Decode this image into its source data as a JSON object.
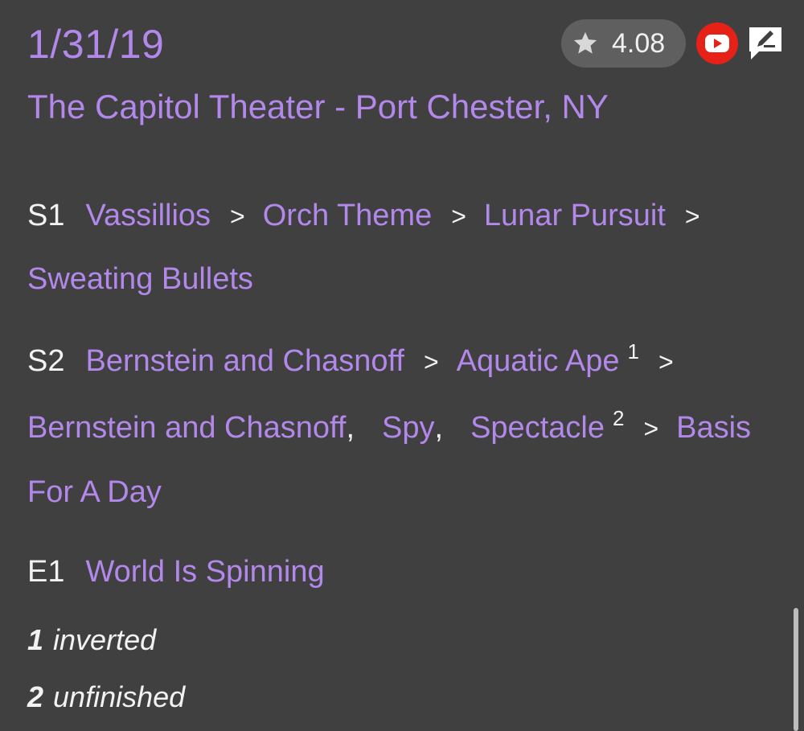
{
  "show": {
    "date": "1/31/19",
    "venue": "The Capitol Theater - Port Chester, NY",
    "rating": "4.08"
  },
  "icons": {
    "rating": "star-icon",
    "video": "youtube-icon",
    "review": "edit-review-icon"
  },
  "colors": {
    "background": "#404040",
    "accent": "#b388eb",
    "text": "#f2f2f2",
    "rating_pill": "#5f5f5f",
    "youtube_red": "#e62117"
  },
  "arrow": ">",
  "comma": ",",
  "sets": [
    {
      "label": "S1",
      "songs": [
        "Vassillios",
        "Orch Theme",
        "Lunar Pursuit",
        "Sweating Bullets"
      ]
    },
    {
      "label": "S2",
      "songs": [
        "Bernstein and Chasnoff",
        "Aquatic Ape",
        "Bernstein and Chasnoff",
        "Spy",
        "Spectacle",
        "Basis",
        "For A Day"
      ],
      "footnote_marks": [
        "1",
        "2"
      ]
    },
    {
      "label": "E1",
      "songs": [
        "World Is Spinning"
      ]
    }
  ],
  "footnotes": [
    {
      "number": "1",
      "text": "inverted"
    },
    {
      "number": "2",
      "text": "unfinished"
    }
  ]
}
